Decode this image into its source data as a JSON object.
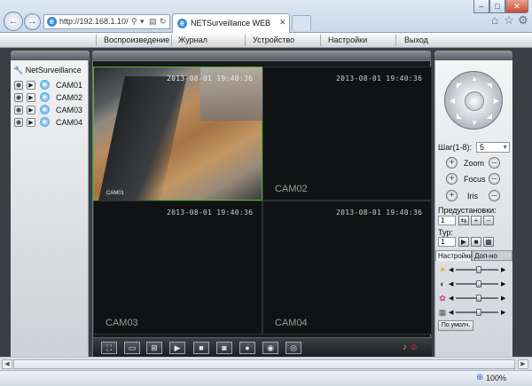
{
  "browser": {
    "url": "http://192.168.1.10/",
    "tab_title": "NETSurveillance WEB",
    "zoom": "100%",
    "icons": [
      "home-icon",
      "favorites-icon",
      "settings-icon"
    ]
  },
  "menu": [
    {
      "id": "playback",
      "label": "Воспроизведение"
    },
    {
      "id": "log",
      "label": "Журнал"
    },
    {
      "id": "device",
      "label": "Устройство"
    },
    {
      "id": "settings",
      "label": "Настройки"
    },
    {
      "id": "exit",
      "label": "Выход"
    }
  ],
  "sidebar": {
    "root_label": "NetSurveillance",
    "cameras": [
      "CAM01",
      "CAM02",
      "CAM03",
      "CAM04"
    ]
  },
  "video": {
    "cells": [
      {
        "timestamp": "2013-08-01 19:40:36",
        "name": "CAM01"
      },
      {
        "timestamp": "2013-08-01 19:40:36",
        "name": "CAM02"
      },
      {
        "timestamp": "2013-08-01 19:40:36",
        "name": "CAM03"
      },
      {
        "timestamp": "2013-08-01 19:40:36",
        "name": "CAM04"
      }
    ]
  },
  "ptz": {
    "step_label": "Шаг(1-8):",
    "step_value": "5",
    "zoom_label": "Zoom",
    "focus_label": "Focus",
    "iris_label": "Iris",
    "presets_label": "Предустановки:",
    "preset_value": "1",
    "tour_label": "Тур:",
    "tour_value": "1"
  },
  "image_tabs": {
    "settings": "Настройки",
    "extra": "Доп-но"
  },
  "sliders": [
    {
      "icon": "brightness-icon",
      "level": 0.55
    },
    {
      "icon": "contrast-icon",
      "level": 0.55
    },
    {
      "icon": "saturation-icon",
      "level": 0.55
    },
    {
      "icon": "hue-icon",
      "level": 0.55
    }
  ],
  "defaults_label": "По умолч."
}
